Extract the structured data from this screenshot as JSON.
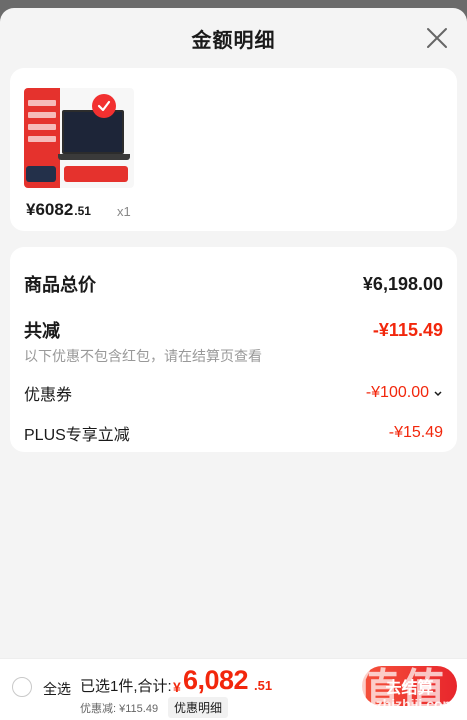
{
  "sheet": {
    "title": "金额明细"
  },
  "product": {
    "price_main": "¥6082",
    "price_decimal": ".51",
    "quantity": "x1"
  },
  "summary": {
    "goods_total_label": "商品总价",
    "goods_total_value": "¥6,198.00",
    "reduction_label": "共减",
    "reduction_value": "-¥115.49",
    "note": "以下优惠不包含红包，请在结算页查看",
    "coupon_label": "优惠券",
    "coupon_value": "-¥100.00",
    "plus_label": "PLUS专享立减",
    "plus_value": "-¥15.49"
  },
  "bottom_bar": {
    "select_all_label": "全选",
    "selected_text": "已选1件,合计:",
    "total_symbol": "¥",
    "total_integer": "6,082",
    "total_decimal": ".51",
    "discount_text": "优惠减: ¥115.49",
    "detail_link": "优惠明细",
    "checkout_label": "去结算"
  },
  "watermark": {
    "chars": "值值值",
    "url": "zhizhiji.com"
  },
  "colors": {
    "accent": "#f2270c",
    "overlay": "#6b6b6b",
    "sheet_bg": "#f4f4f4"
  },
  "icons": {
    "close": "close-icon",
    "check": "check-icon",
    "chevron": "chevron-down-icon",
    "radio": "radio-unchecked-icon"
  }
}
